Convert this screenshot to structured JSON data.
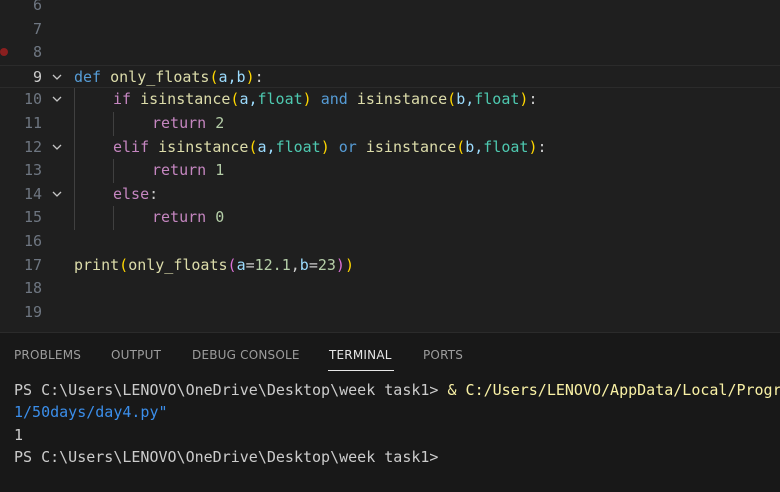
{
  "editor": {
    "lines": [
      {
        "number": "6"
      },
      {
        "number": "7"
      },
      {
        "number": "8"
      },
      {
        "number": "9",
        "def_kw": "def",
        "fn_name": "only_floats",
        "p_open": "(",
        "params": "a,b",
        "p_close": ")",
        "colon": ":"
      },
      {
        "number": "10",
        "kw": "if",
        "fn1": "isinstance",
        "o1": "(",
        "a1": "a,",
        "c1": "float",
        "cl1": ")",
        "op": "and",
        "fn2": "isinstance",
        "o2": "(",
        "a2": "b,",
        "c2": "float",
        "cl2": ")",
        "colon": ":"
      },
      {
        "number": "11",
        "kw": "return",
        "num": "2"
      },
      {
        "number": "12",
        "kw": "elif",
        "fn1": "isinstance",
        "o1": "(",
        "a1": "a,",
        "c1": "float",
        "cl1": ")",
        "op": "or",
        "fn2": "isinstance",
        "o2": "(",
        "a2": "b,",
        "c2": "float",
        "cl2": ")",
        "colon": ":"
      },
      {
        "number": "13",
        "kw": "return",
        "num": "1"
      },
      {
        "number": "14",
        "kw": "else",
        "colon": ":"
      },
      {
        "number": "15",
        "kw": "return",
        "num": "0"
      },
      {
        "number": "16"
      },
      {
        "number": "17",
        "fn1": "print",
        "o1": "(",
        "fn2": "only_floats",
        "o2": "(",
        "pa": "a",
        "eq1": "=",
        "va": "12.1",
        "comma": ",",
        "pb": "b",
        "eq2": "=",
        "vb": "23",
        "cl2": ")",
        "cl1": ")"
      },
      {
        "number": "18"
      },
      {
        "number": "19"
      }
    ]
  },
  "panel": {
    "tabs": [
      {
        "label": "PROBLEMS"
      },
      {
        "label": "OUTPUT"
      },
      {
        "label": "DEBUG CONSOLE"
      },
      {
        "label": "TERMINAL"
      },
      {
        "label": "PORTS"
      }
    ],
    "terminal": {
      "line1_prompt": "PS C:\\Users\\LENOVO\\OneDrive\\Desktop\\week task1> ",
      "line1_amp": "& ",
      "line1_path": "C:/Users/LENOVO/AppData/Local/Progr",
      "line2": "1/50days/day4.py\"",
      "line3": "1",
      "line4_prompt": "PS C:\\Users\\LENOVO\\OneDrive\\Desktop\\week task1>"
    }
  }
}
